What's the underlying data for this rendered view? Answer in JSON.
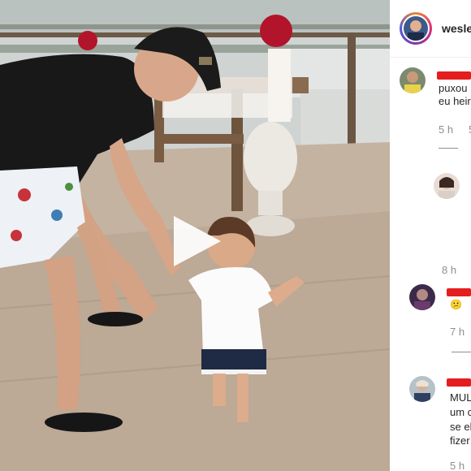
{
  "post": {
    "username": "wesley",
    "video_label": "play-video"
  },
  "comments": [
    {
      "lines": [
        "puxou",
        "eu heir"
      ],
      "meta": "5 h",
      "meta_extra": "5"
    },
    {
      "lines": [],
      "meta": "8 h"
    },
    {
      "lines": [
        "😕"
      ],
      "meta": "7 h"
    },
    {
      "lines": [
        "MUL",
        "um c",
        "se el",
        "fizer"
      ],
      "meta": "5 h"
    }
  ]
}
